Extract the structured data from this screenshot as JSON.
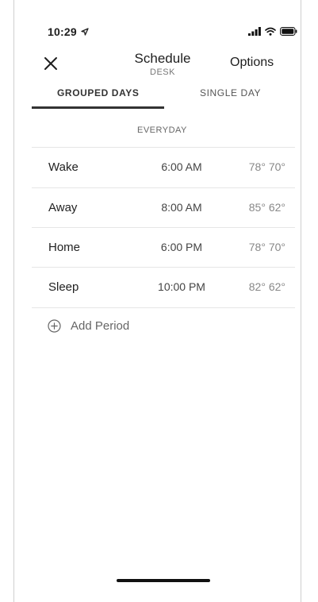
{
  "status_bar": {
    "time": "10:29",
    "location_icon": "location-arrow-icon",
    "signal_icon": "cellular-signal-icon",
    "wifi_icon": "wifi-icon",
    "battery_icon": "battery-icon"
  },
  "header": {
    "close_icon": "close-icon",
    "title": "Schedule",
    "subtitle": "DESK",
    "options_label": "Options"
  },
  "tabs": [
    {
      "label": "GROUPED DAYS",
      "active": true
    },
    {
      "label": "SINGLE DAY",
      "active": false
    }
  ],
  "section": {
    "label": "EVERYDAY"
  },
  "periods": [
    {
      "name": "Wake",
      "time": "6:00 AM",
      "temps": "78° 70°"
    },
    {
      "name": "Away",
      "time": "8:00 AM",
      "temps": "85° 62°"
    },
    {
      "name": "Home",
      "time": "6:00 PM",
      "temps": "78° 70°"
    },
    {
      "name": "Sleep",
      "time": "10:00 PM",
      "temps": "82° 62°"
    }
  ],
  "add_period": {
    "icon": "add-circle-icon",
    "label": "Add Period"
  }
}
